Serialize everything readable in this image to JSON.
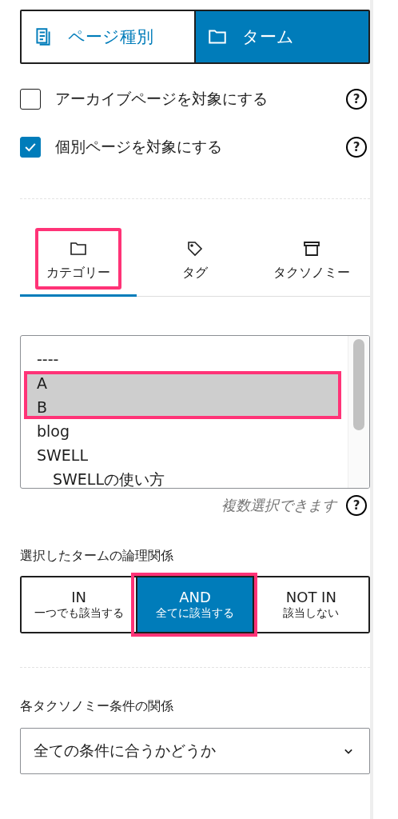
{
  "mode_toggle": [
    {
      "label": "ページ種別",
      "selected": false
    },
    {
      "label": "ターム",
      "selected": true
    }
  ],
  "options": [
    {
      "label": "アーカイブページを対象にする",
      "checked": false,
      "help": "?"
    },
    {
      "label": "個別ページを対象にする",
      "checked": true,
      "help": "?"
    }
  ],
  "taxonomy_tabs": [
    {
      "label": "カテゴリー",
      "selected": true,
      "annotated": true
    },
    {
      "label": "タグ",
      "selected": false,
      "annotated": false
    },
    {
      "label": "タクソノミー",
      "selected": false,
      "annotated": false
    }
  ],
  "term_list": {
    "items": [
      {
        "label": "----",
        "selected": false,
        "annotated": false
      },
      {
        "label": "A",
        "selected": true,
        "annotated": true
      },
      {
        "label": "B",
        "selected": true,
        "annotated": true
      },
      {
        "label": "blog",
        "selected": false,
        "annotated": false
      },
      {
        "label": "SWELL",
        "selected": false,
        "annotated": false,
        "children": [
          {
            "label": "SWELLの使い方",
            "selected": false,
            "annotated": false
          }
        ]
      }
    ],
    "hint": "複数選択できます",
    "help": "?"
  },
  "logic": {
    "label": "選択したタームの論理関係",
    "buttons": [
      {
        "title": "IN",
        "sub": "一つでも該当する",
        "selected": false,
        "annotated": false
      },
      {
        "title": "AND",
        "sub": "全てに該当する",
        "selected": true,
        "annotated": true
      },
      {
        "title": "NOT IN",
        "sub": "該当しない",
        "selected": false,
        "annotated": false
      }
    ]
  },
  "relation": {
    "label": "各タクソノミー条件の関係",
    "value": "全ての条件に合うかどうか"
  }
}
